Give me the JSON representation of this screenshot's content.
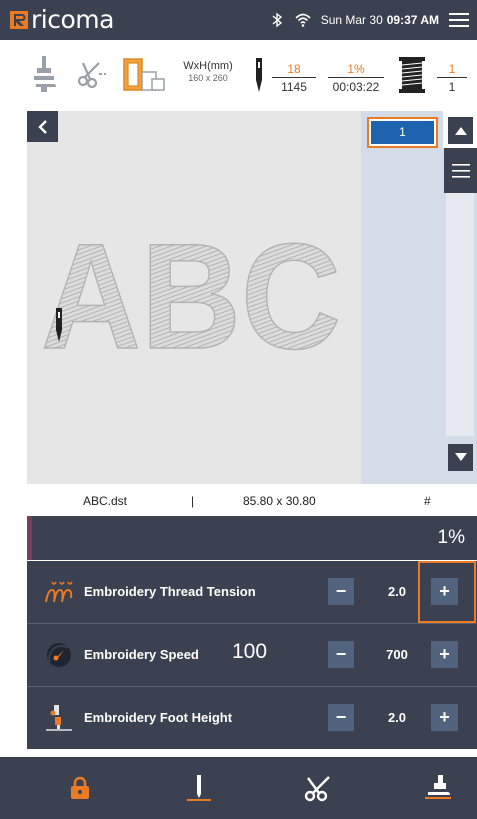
{
  "status_bar": {
    "brand": "ricoma",
    "date": "Sun Mar 30",
    "time": "09:37 AM",
    "icons": [
      "bluetooth-icon",
      "wifi-icon",
      "menu-icon"
    ]
  },
  "toolbar": {
    "icons": [
      "presser-foot-icon",
      "trim-icon",
      "hoop-icon",
      "needle-icon",
      "thread-spool-icon"
    ],
    "size_label": "WxH(mm)",
    "size_value": "160 x 260",
    "stitch_current": "18",
    "stitch_total": "1145",
    "progress_percent": "1%",
    "elapsed_time": "00:03:22",
    "color_current": "1",
    "color_total": "1"
  },
  "canvas": {
    "design_text": "ABC",
    "back_icon": "chevron-left-icon"
  },
  "color_panel": {
    "selected_color_number": "1",
    "selected_color": "#1e63ad",
    "scroll_up_icon": "triangle-up-icon",
    "scroll_down_icon": "triangle-down-icon",
    "list_icon": "list-icon"
  },
  "file_info": {
    "filename": "ABC.dst",
    "separator": "|",
    "dimensions": "85.80 x 30.80",
    "hash": "#"
  },
  "progress": {
    "percent_label": "1%",
    "fraction": 0.01
  },
  "settings": [
    {
      "icon": "thread-tension-icon",
      "label": "Embroidery Thread Tension",
      "extra": "",
      "value": "2.0"
    },
    {
      "icon": "speed-gauge-icon",
      "label": "Embroidery Speed",
      "extra": "100",
      "value": "700"
    },
    {
      "icon": "foot-height-icon",
      "label": "Embroidery Foot Height",
      "extra": "",
      "value": "2.0"
    }
  ],
  "controls": {
    "minus": "−",
    "plus": "+"
  },
  "bottom_bar": {
    "items": [
      "lock-icon",
      "needle-position-icon",
      "trim-icon",
      "presser-foot-icon"
    ]
  },
  "colors": {
    "dark": "#3b4150",
    "accent": "#ea7a24",
    "button": "#52647d",
    "panel": "#d4dce7"
  }
}
